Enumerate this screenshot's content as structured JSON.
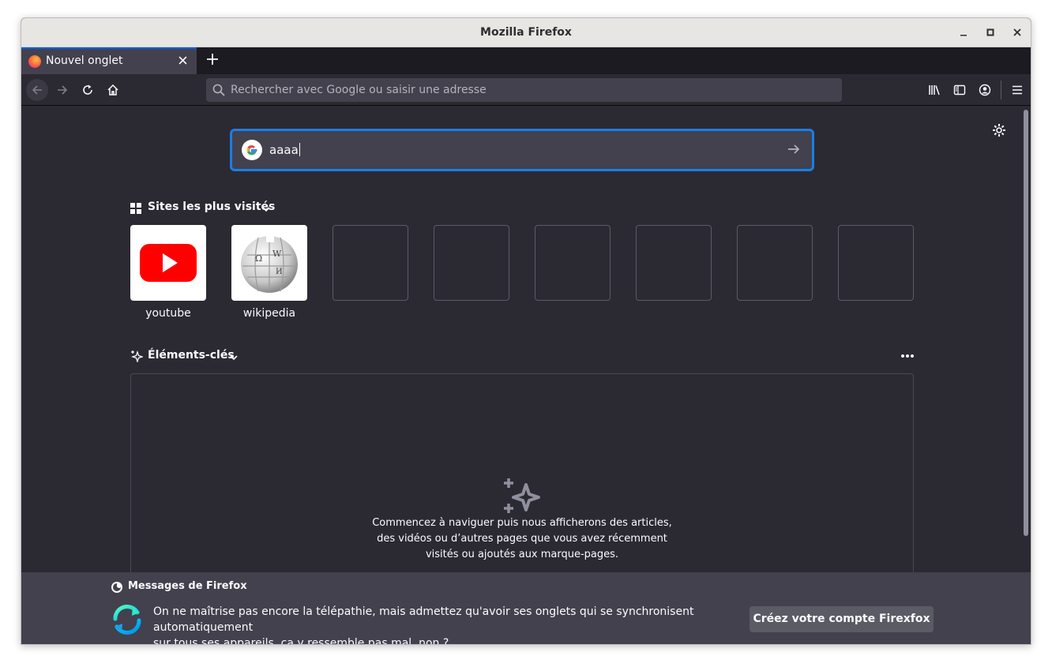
{
  "window": {
    "title": "Mozilla Firefox",
    "controls": [
      "minimize",
      "maximize",
      "close"
    ]
  },
  "tab": {
    "label": "Nouvel onglet"
  },
  "urlbar": {
    "placeholder": "Rechercher avec Google ou saisir une adresse"
  },
  "search": {
    "value": "aaaa"
  },
  "top_sites": {
    "title": "Sites les plus visités",
    "sites": [
      {
        "label": "youtube"
      },
      {
        "label": "wikipedia"
      }
    ]
  },
  "highlights": {
    "title": "Éléments-clés",
    "empty_lines": [
      "Commencez à naviguer puis nous afficherons des articles,",
      "des vidéos ou d’autres pages que vous avez récemment",
      "visités ou ajoutés aux marque-pages."
    ]
  },
  "messages": {
    "title": "Messages de Firefox",
    "text_line1": "On ne maîtrise pas encore la télépathie, mais admettez qu'avoir ses onglets qui se synchronisent automatiquement",
    "text_line2": "sur tous ses appareils, ça y ressemble pas mal, non ?",
    "button": "Créez votre compte Firexfox"
  },
  "colors": {
    "accent": "#0a84ff",
    "background": "#2b2a33",
    "youtube_red": "#ff0000"
  }
}
